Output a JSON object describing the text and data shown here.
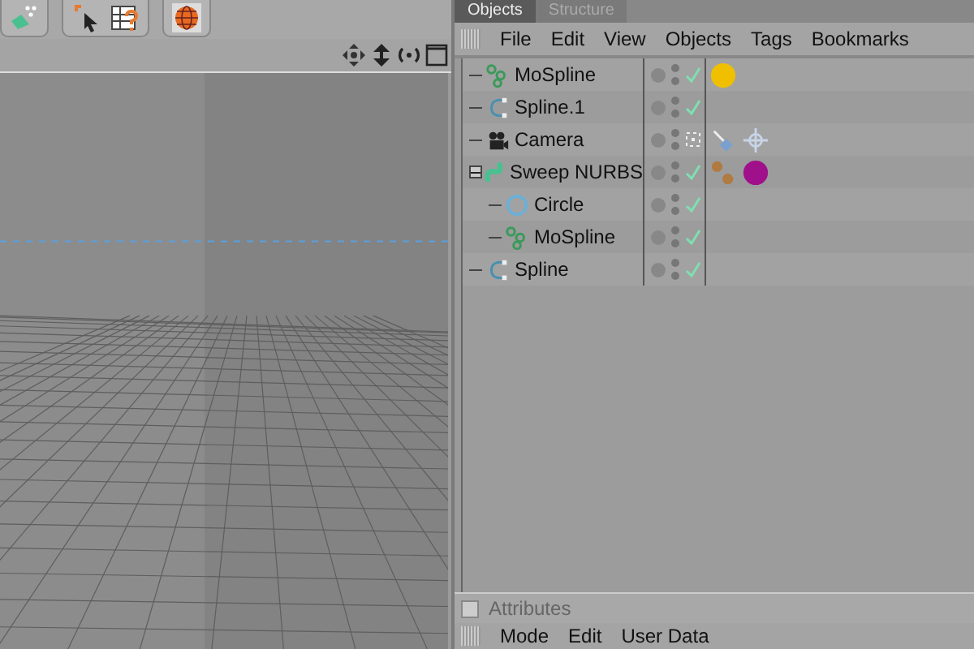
{
  "panel_tabs": [
    {
      "label": "Objects",
      "selected": true
    },
    {
      "label": "Structure",
      "selected": false
    }
  ],
  "object_menu": [
    "File",
    "Edit",
    "View",
    "Objects",
    "Tags",
    "Bookmarks"
  ],
  "objects": [
    {
      "name": "MoSpline",
      "kind": "mospline",
      "checked": true,
      "tags": [
        {
          "kind": "material",
          "color": "#f0c000"
        }
      ]
    },
    {
      "name": "Spline.1",
      "kind": "spline",
      "checked": true
    },
    {
      "name": "Camera",
      "kind": "camera",
      "checked": false,
      "tags": [
        {
          "kind": "pointer"
        },
        {
          "kind": "target"
        }
      ]
    },
    {
      "name": "Sweep NURBS",
      "kind": "sweep",
      "checked": true,
      "expanded": true,
      "tags": [
        {
          "kind": "balls"
        },
        {
          "kind": "material",
          "color": "#a0108a"
        }
      ],
      "children": [
        {
          "name": "Circle",
          "kind": "circle",
          "checked": true
        },
        {
          "name": "MoSpline",
          "kind": "mospline",
          "checked": true
        }
      ]
    },
    {
      "name": "Spline",
      "kind": "spline",
      "checked": true
    }
  ],
  "attributes": {
    "title": "Attributes",
    "checked": false,
    "menu": [
      "Mode",
      "Edit",
      "User Data"
    ]
  }
}
